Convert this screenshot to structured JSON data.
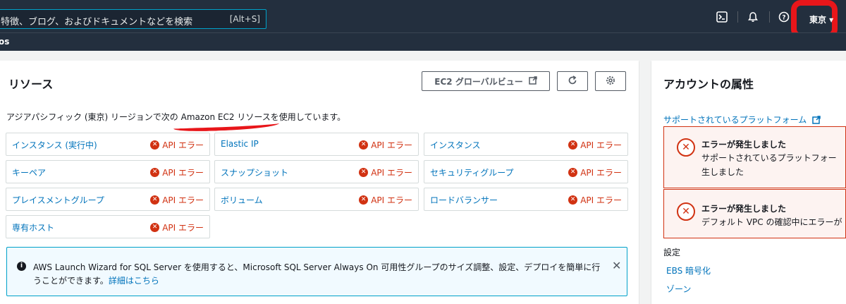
{
  "topbar": {
    "search_placeholder": "特徴、ブログ、およびドキュメントなどを検索",
    "search_shortcut": "[Alt+S]",
    "region": "東京 ▾"
  },
  "subbar": {
    "text": "os"
  },
  "resources": {
    "title": "リソース",
    "global_view_button": "EC2 グローバルビュー",
    "description": "アジアパシフィック (東京) リージョンで次の Amazon EC2 リソースを使用しています。",
    "error_label": "API エラー",
    "items": [
      {
        "name": "インスタンス (実行中)"
      },
      {
        "name": "Elastic IP"
      },
      {
        "name": "インスタンス"
      },
      {
        "name": "キーペア"
      },
      {
        "name": "スナップショット"
      },
      {
        "name": "セキュリティグループ"
      },
      {
        "name": "プレイスメントグループ"
      },
      {
        "name": "ボリューム"
      },
      {
        "name": "ロードバランサー"
      },
      {
        "name": "専有ホスト"
      }
    ],
    "info_line1": "AWS Launch Wizard for SQL Server を使用すると、Microsoft SQL Server Always On 可用性グループのサイズ調整、設定、デプロイを簡単に行",
    "info_line2": "うことができます。",
    "info_link": "詳細はこちら"
  },
  "account": {
    "title": "アカウントの属性",
    "support_link": "サポートされているプラットフォーム",
    "alert1_title": "エラーが発生しました",
    "alert1_msg1": "サポートされているプラットフォー",
    "alert1_msg2": "生しました",
    "alert2_title": "エラーが発生しました",
    "alert2_msg": "デフォルト VPC の確認中にエラーが",
    "settings_label": "設定",
    "ebs_link": "EBS 暗号化",
    "zone_link": "ゾーン"
  },
  "colors": {
    "accent": "#0073bb",
    "error": "#d13212",
    "header": "#232f3e",
    "annotation": "#e8161a"
  }
}
